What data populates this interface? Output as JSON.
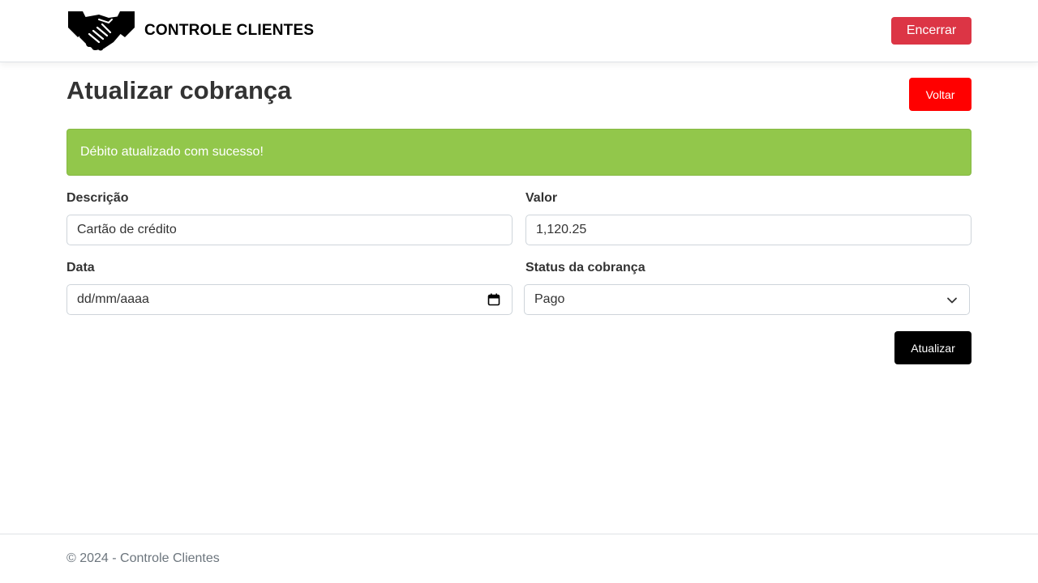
{
  "header": {
    "brand_name": "CONTROLE CLIENTES",
    "logo_icon": "handshake-icon",
    "logout_label": "Encerrar",
    "logout_color": "#dc3545"
  },
  "page": {
    "title": "Atualizar cobrança",
    "back_label": "Voltar",
    "back_color": "#ff0000"
  },
  "alert": {
    "message": "Débito atualizado com sucesso!",
    "color": "#92c74b"
  },
  "form": {
    "descricao": {
      "label": "Descrição",
      "value": "Cartão de crédito"
    },
    "valor": {
      "label": "Valor",
      "value": "1,120.25"
    },
    "data": {
      "label": "Data",
      "placeholder": "dd/mm/aaaa",
      "icon": "calendar-icon"
    },
    "status": {
      "label": "Status da cobrança",
      "selected": "Pago",
      "icon": "chevron-down-icon"
    },
    "submit_label": "Atualizar"
  },
  "footer": {
    "text": "© 2024 - Controle Clientes"
  }
}
